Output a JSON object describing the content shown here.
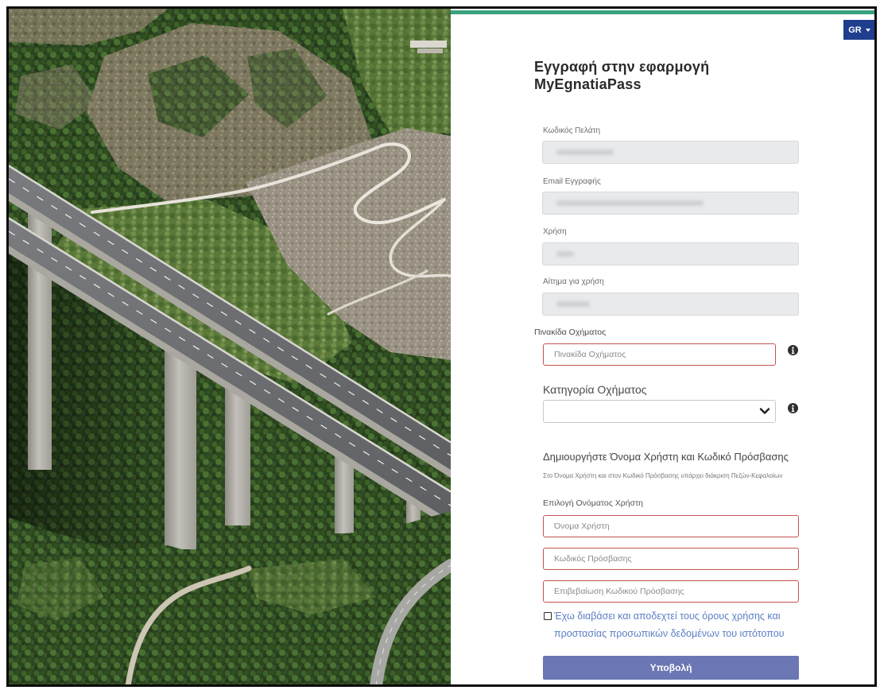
{
  "colors": {
    "accent_bar": "#3ba37f",
    "language_button": "#1f3e8e",
    "error_border": "#c25450",
    "link": "#5b7ec4",
    "submit_button": "#6b76b4",
    "disabled_field": "#e9eaec"
  },
  "language_selector": {
    "label": "GR",
    "icon": "caret-down-icon"
  },
  "form": {
    "title_line1": "Εγγραφή στην εφαρμογή",
    "title_line2": "MyEgnatiaPass",
    "customer_code": {
      "label": "Κωδικός Πελάτη",
      "disabled": true
    },
    "registration_email": {
      "label": "Email Εγγραφής",
      "disabled": true
    },
    "usage": {
      "label": "Χρήση",
      "disabled": true
    },
    "usage_request": {
      "label": "Αίτημα για χρήση",
      "disabled": true
    },
    "vehicle_plate": {
      "label": "Πινακίδα Οχήματος",
      "placeholder": "Πινακίδα Οχήματος",
      "info_icon": "info-circle-icon"
    },
    "vehicle_category": {
      "label": "Κατηγορία Οχήματος",
      "selected": "",
      "icon": "chevron-down-icon",
      "info_icon": "info-circle-icon"
    },
    "credentials": {
      "heading": "Δημιουργήστε Όνομα Χρήστη και Κωδικό Πρόσβασης",
      "note": "Στο Όνομα Χρήστη και στον Κωδικό Πρόσβασης υπάρχει διάκριση Πεζών-Κεφαλαίων",
      "username_label": "Επιλογή Ονόματος Χρήστη",
      "username_placeholder": "Όνομα Χρήστη",
      "password_placeholder": "Κωδικός Πρόσβασης",
      "confirm_password_placeholder": "Επιβεβαίωση Κωδικού Πρόσβασης"
    },
    "terms": {
      "checked": false,
      "text": "Έχω διαβάσει και αποδεχτεί τους όρους χρήσης και προστασίας προσωπικών δεδομένων του ιστότοπου"
    },
    "submit_label": "Υποβολή"
  }
}
